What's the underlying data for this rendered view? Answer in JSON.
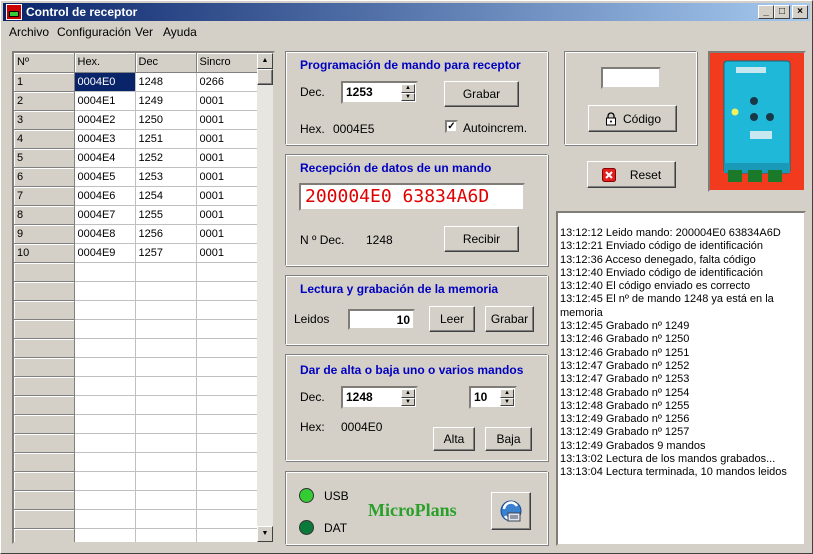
{
  "window": {
    "title": "Control de receptor",
    "btn_min": "_",
    "btn_max": "□",
    "btn_close": "×"
  },
  "menu": [
    "Archivo",
    "Configuración",
    "Ver",
    "Ayuda"
  ],
  "grid": {
    "headers": [
      "Nº",
      "Hex.",
      "Dec",
      "Sincro"
    ],
    "rows": [
      [
        "1",
        "0004E0",
        "1248",
        "0266"
      ],
      [
        "2",
        "0004E1",
        "1249",
        "0001"
      ],
      [
        "3",
        "0004E2",
        "1250",
        "0001"
      ],
      [
        "4",
        "0004E3",
        "1251",
        "0001"
      ],
      [
        "5",
        "0004E4",
        "1252",
        "0001"
      ],
      [
        "6",
        "0004E5",
        "1253",
        "0001"
      ],
      [
        "7",
        "0004E6",
        "1254",
        "0001"
      ],
      [
        "8",
        "0004E7",
        "1255",
        "0001"
      ],
      [
        "9",
        "0004E8",
        "1256",
        "0001"
      ],
      [
        "10",
        "0004E9",
        "1257",
        "0001"
      ]
    ]
  },
  "programacion": {
    "title": "Programación de mando para receptor",
    "dec_label": "Dec.",
    "dec_value": "1253",
    "grabar": "Grabar",
    "hex_label": "Hex.",
    "hex_value": "0004E5",
    "autoincrem": "Autoincrem.",
    "autoincrem_checked": true
  },
  "recepcion": {
    "title": "Recepción de datos de un mando",
    "display": "200004E0 63834A6D",
    "ndec_label": "N º Dec.",
    "ndec_value": "1248",
    "recibir": "Recibir"
  },
  "lectura": {
    "title": "Lectura y grabación de la memoria",
    "leidos_label": "Leidos",
    "leidos_value": "10",
    "leer": "Leer",
    "grabar": "Grabar"
  },
  "alta": {
    "title": "Dar de alta o baja uno o varios mandos",
    "dec_label": "Dec.",
    "dec_value": "1248",
    "count_value": "10",
    "hex_label": "Hex:",
    "hex_value": "0004E0",
    "alta": "Alta",
    "baja": "Baja"
  },
  "status": {
    "usb": "USB",
    "dat": "DAT",
    "usb_color": "#33cc33",
    "dat_color": "#0a7a3a",
    "brand": "MicroPlans"
  },
  "codigo": {
    "input_value": "",
    "button": "Código",
    "reset": "Reset"
  },
  "log": [
    "13:12:12 Leido mando: 200004E0 63834A6D",
    "13:12:21 Enviado código de identificación",
    "13:12:36 Acceso denegado, falta código",
    "13:12:40 Enviado código de identificación",
    "13:12:40 El código enviado es correcto",
    "13:12:45 El nº de mando 1248 ya está en la",
    "memoria",
    "13:12:45 Grabado nº 1249",
    "13:12:46 Grabado nº 1250",
    "13:12:46 Grabado nº 1251",
    "13:12:47 Grabado nº 1252",
    "13:12:47 Grabado nº 1253",
    "13:12:48 Grabado nº 1254",
    "13:12:48 Grabado nº 1255",
    "13:12:49 Grabado nº 1256",
    "13:12:49 Grabado nº 1257",
    "13:12:49 Grabados 9 mandos",
    "13:13:02 Lectura de los mandos grabados...",
    "13:13:04 Lectura terminada, 10 mandos leidos"
  ]
}
